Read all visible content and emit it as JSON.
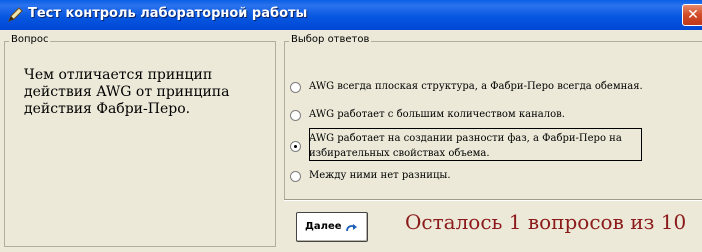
{
  "window": {
    "title": "Тест контроль лабораторной работы",
    "close_symbol": "✕",
    "icon": "pen-icon",
    "close_color": "#d24a25",
    "titlebar_color": "#0757e0"
  },
  "question_panel": {
    "legend": "Вопрос",
    "text": "Чем отличается принцип действия AWG от принципа действия Фабри-Перо."
  },
  "answers_panel": {
    "legend": "Выбор ответов",
    "options": [
      {
        "label": "AWG всегда плоская структура, а Фабри-Перо всегда обемная.",
        "selected": false
      },
      {
        "label": "AWG работает с большим количеством каналов.",
        "selected": false
      },
      {
        "label_line1": "AWG работает на создании разности фаз, а Фабри-Перо на",
        "label_line2": "избирательных свойствах объема.",
        "selected": true
      },
      {
        "label": "Между ними нет разницы.",
        "selected": false
      }
    ]
  },
  "footer": {
    "next_button_label": "Далее",
    "next_icon": "redo-arrow-icon",
    "status_text": "Осталось 1 вопросов из 10",
    "status_color": "#8b1a1a"
  }
}
